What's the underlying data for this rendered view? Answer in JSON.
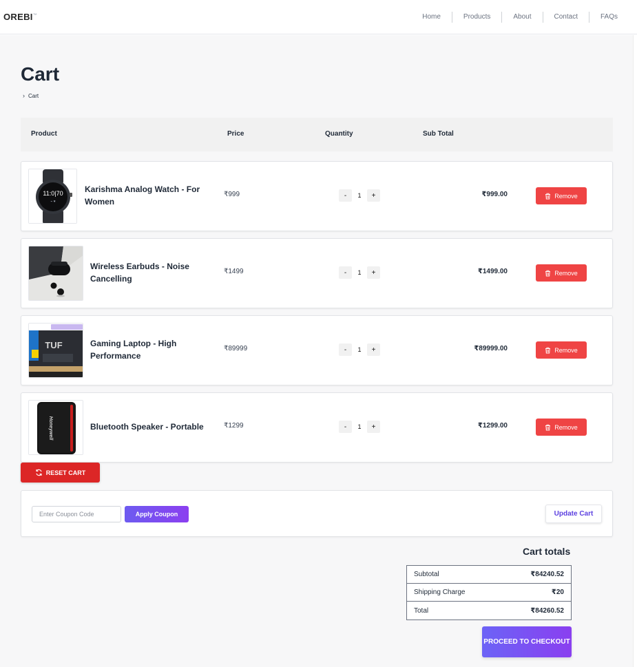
{
  "header": {
    "logo": "OREBI",
    "nav": [
      "Home",
      "Products",
      "About",
      "Contact",
      "FAQs"
    ]
  },
  "page": {
    "title": "Cart",
    "breadcrumb": "Cart"
  },
  "table_headers": {
    "product": "Product",
    "price": "Price",
    "quantity": "Quantity",
    "subtotal": "Sub Total"
  },
  "cart_items": [
    {
      "name": "Karishma Analog Watch - For Women",
      "price": "₹999",
      "qty": "1",
      "subtotal": "₹999.00",
      "thumb_icon": "smartwatch-image"
    },
    {
      "name": "Wireless Earbuds - Noise Cancelling",
      "price": "₹1499",
      "qty": "1",
      "subtotal": "₹1499.00",
      "thumb_icon": "earbuds-image"
    },
    {
      "name": "Gaming Laptop - High Performance",
      "price": "₹89999",
      "qty": "1",
      "subtotal": "₹89999.00",
      "thumb_icon": "laptop-image"
    },
    {
      "name": "Bluetooth Speaker - Portable",
      "price": "₹1299",
      "qty": "1",
      "subtotal": "₹1299.00",
      "thumb_icon": "speaker-image"
    }
  ],
  "labels": {
    "remove": "Remove",
    "minus": "-",
    "plus": "+",
    "reset_cart": "RESET CART",
    "coupon_placeholder": "Enter Coupon Code",
    "apply_coupon": "Apply Coupon",
    "update_cart": "Update Cart",
    "cart_totals": "Cart totals",
    "proceed": "PROCEED TO CHECKOUT"
  },
  "totals": {
    "subtotal_label": "Subtotal",
    "subtotal_value": "₹84240.52",
    "shipping_label": "Shipping Charge",
    "shipping_value": "₹20",
    "total_label": "Total",
    "total_value": "₹84260.52"
  },
  "colors": {
    "remove": "#ef4444",
    "reset": "#dc2626",
    "accent_start": "#6c63f6",
    "accent_end": "#8a3ff0"
  }
}
